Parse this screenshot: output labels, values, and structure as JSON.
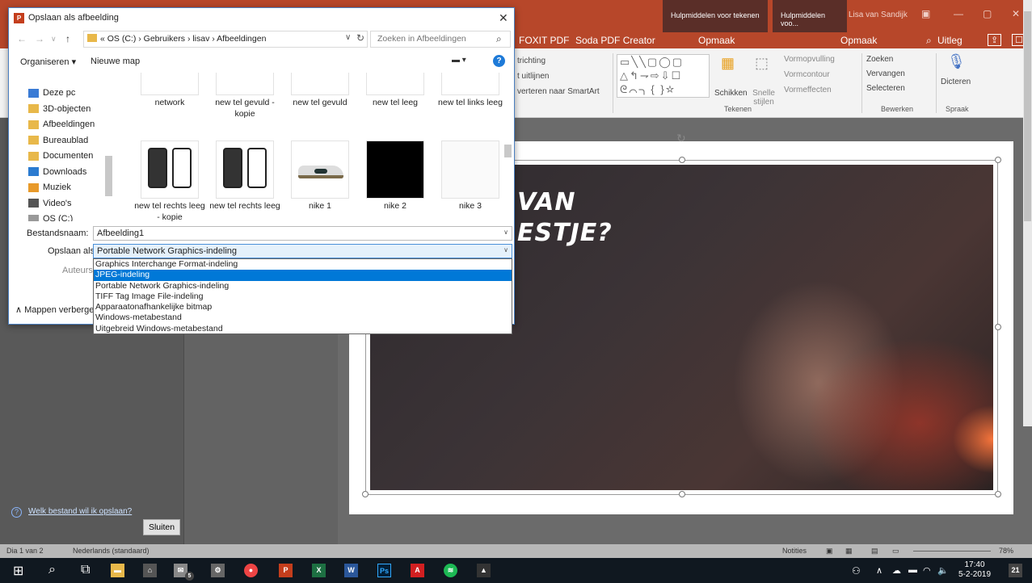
{
  "powerpoint": {
    "contextual_tabs": [
      "Hulpmiddelen voor tekenen",
      "Hulpmiddelen voo..."
    ],
    "user": "Lisa van Sandijk",
    "ribbon_tabs": [
      "FOXIT PDF",
      "Soda PDF Creator",
      "Opmaak",
      "Opmaak",
      "Uitleg"
    ],
    "ribbon": {
      "paragraph": [
        "trichting",
        "t uitlijnen",
        "verteren naar SmartArt"
      ],
      "schikken": "Schikken",
      "snelle_stijlen": "Snelle stijlen",
      "vormopvulling": "Vormopvulling",
      "vormcontour": "Vormcontour",
      "vormeffecten": "Vormeffecten",
      "zoeken": "Zoeken",
      "vervangen": "Vervangen",
      "selecteren": "Selecteren",
      "dicteren": "Dicteren",
      "groups": {
        "tekenen": "Tekenen",
        "bewerken": "Bewerken",
        "spraak": "Spraak"
      }
    },
    "slide_heading": "VAN ESTJE?",
    "statusbar": {
      "slide": "Dia 1 van 2",
      "language": "Nederlands (standaard)",
      "notes": "Notities",
      "zoom": "78%"
    }
  },
  "dialog": {
    "title": "Opslaan als afbeelding",
    "app_icon": "P",
    "address_path": "« OS (C:) › Gebruikers › lisav › Afbeeldingen",
    "search_placeholder": "Zoeken in Afbeeldingen",
    "toolbar": {
      "organize": "Organiseren ▾",
      "new_folder": "Nieuwe map"
    },
    "nav_items": [
      {
        "label": "Deze pc",
        "icon": "computer-icon"
      },
      {
        "label": "3D-objecten",
        "icon": "folder-icon"
      },
      {
        "label": "Afbeeldingen",
        "icon": "folder-icon"
      },
      {
        "label": "Bureaublad",
        "icon": "folder-icon"
      },
      {
        "label": "Documenten",
        "icon": "folder-icon"
      },
      {
        "label": "Downloads",
        "icon": "download-icon"
      },
      {
        "label": "Muziek",
        "icon": "music-icon"
      },
      {
        "label": "Video's",
        "icon": "video-icon"
      },
      {
        "label": "OS (C:)",
        "icon": "drive-icon"
      }
    ],
    "files_row1": [
      "network",
      "new tel gevuld - kopie",
      "new tel gevuld",
      "new tel leeg",
      "new tel links leeg"
    ],
    "files_row2": [
      "new tel rechts leeg - kopie",
      "new tel rechts leeg",
      "nike 1",
      "nike 2",
      "nike 3"
    ],
    "filename_label": "Bestandsnaam:",
    "filename_value": "Afbeelding1",
    "filetype_label": "Opslaan als:",
    "filetype_value": "Portable Network Graphics-indeling",
    "authors_label": "Auteurs:",
    "filetype_options": [
      "Graphics Interchange Format-indeling",
      "JPEG-indeling",
      "Portable Network Graphics-indeling",
      "TIFF Tag Image File-indeling",
      "Apparaatonafhankelijke bitmap",
      "Windows-metabestand",
      "Uitgebreid Windows-metabestand"
    ],
    "selected_option_index": 1,
    "hide_folders": "Mappen verbergen",
    "help_link": "Welk bestand wil ik opslaan?",
    "close_button": "Sluiten"
  },
  "taskbar": {
    "time": "17:40",
    "date": "5-2-2019",
    "mail_badge": "5",
    "notifications": "21"
  },
  "colors": {
    "ppt_accent": "#b7472a",
    "selection": "#0078d7"
  }
}
